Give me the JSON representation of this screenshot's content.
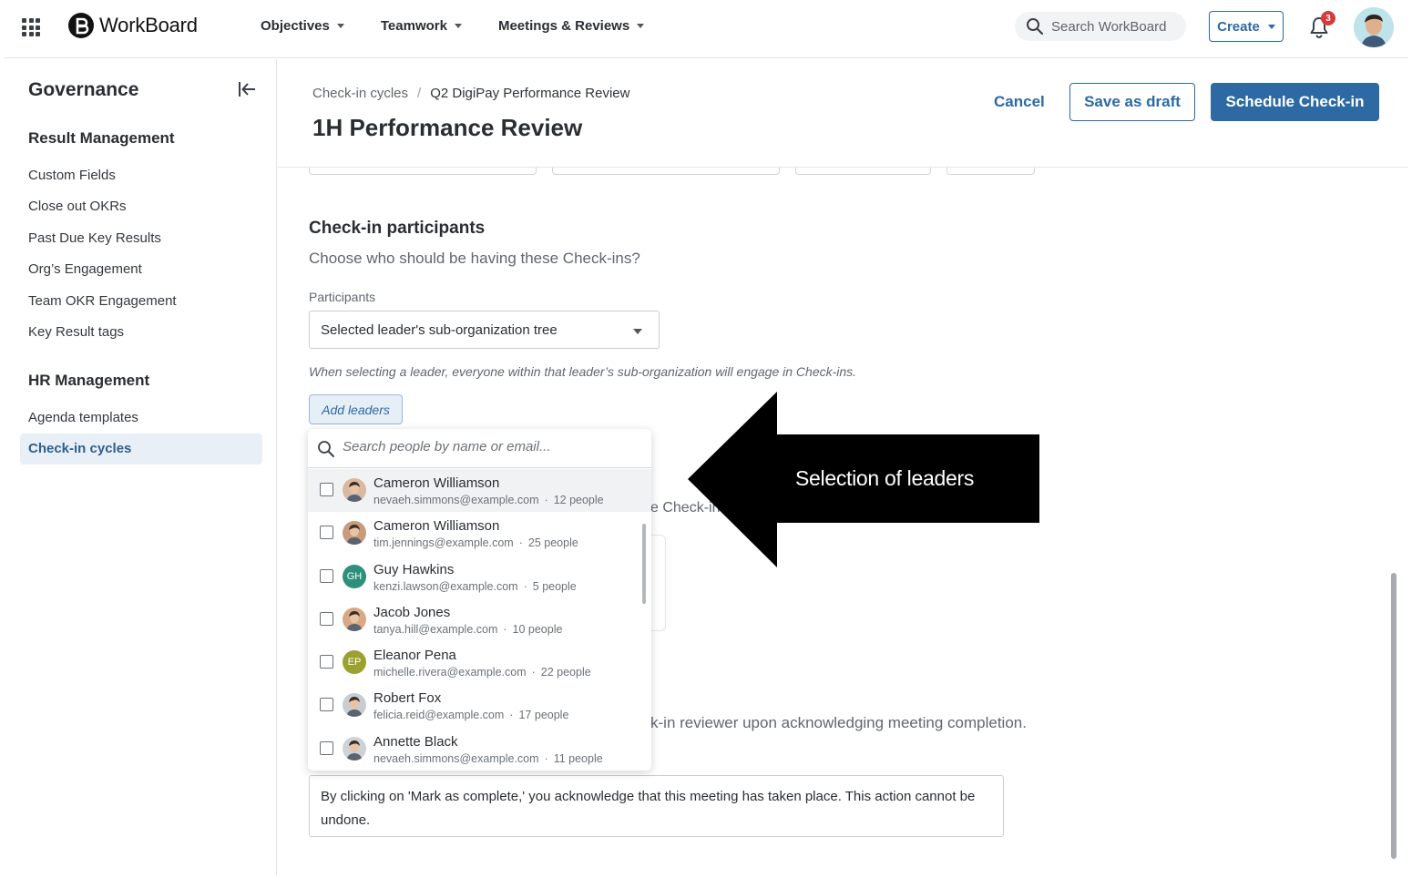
{
  "app": {
    "name": "WorkBoard"
  },
  "topnav": {
    "menus": [
      {
        "label": "Objectives"
      },
      {
        "label": "Teamwork"
      },
      {
        "label": "Meetings & Reviews"
      }
    ],
    "search_placeholder": "Search WorkBoard",
    "create_label": "Create",
    "notifications_count": "3"
  },
  "sidebar": {
    "title": "Governance",
    "sections": [
      {
        "title": "Result Management",
        "items": [
          "Custom Fields",
          "Close out OKRs",
          "Past Due Key Results",
          "Org’s Engagement",
          "Team OKR Engagement",
          "Key Result tags"
        ]
      },
      {
        "title": "HR Management",
        "items": [
          "Agenda templates",
          "Check-in cycles"
        ]
      }
    ],
    "active_item": "Check-in cycles"
  },
  "header": {
    "breadcrumb": [
      "Check-in cycles",
      "/",
      "Q2 DigiPay Performance Review"
    ],
    "title": "1H Performance Review",
    "cancel_label": "Cancel",
    "draft_label": "Save as draft",
    "schedule_label": "Schedule Check-in"
  },
  "participants": {
    "title": "Check-in participants",
    "subtitle": "Choose who should be having these Check-ins?",
    "field_label": "Participants",
    "selected": "Selected leader's sub-organization tree",
    "hint": "When selecting a leader, everyone within that leader’s sub-organization will engage in Check-ins.",
    "add_leaders_label": "Add leaders"
  },
  "leader_picker": {
    "search_placeholder": "Search people by name or email...",
    "people": [
      {
        "name": "Cameron Williamson",
        "email": "nevaeh.simmons@example.com",
        "count": "12 people",
        "initials": "",
        "avatar_color": "#d9b9a1"
      },
      {
        "name": "Cameron Williamson",
        "email": "tim.jennings@example.com",
        "count": "25 people",
        "initials": "",
        "avatar_color": "#c79b7b"
      },
      {
        "name": "Guy Hawkins",
        "email": "kenzi.lawson@example.com",
        "count": "5 people",
        "initials": "GH",
        "avatar_color": "#2e8f7a"
      },
      {
        "name": "Jacob Jones",
        "email": "tanya.hill@example.com",
        "count": "10 people",
        "initials": "",
        "avatar_color": "#d8a984"
      },
      {
        "name": "Eleanor Pena",
        "email": "michelle.rivera@example.com",
        "count": "22 people",
        "initials": "EP",
        "avatar_color": "#9aa12f"
      },
      {
        "name": "Robert Fox",
        "email": "felicia.reid@example.com",
        "count": "17 people",
        "initials": "",
        "avatar_color": "#c8cdd2"
      },
      {
        "name": "Annette Black",
        "email": "nevaeh.simmons@example.com",
        "count": "11 people",
        "initials": "",
        "avatar_color": "#cfd3d6"
      }
    ],
    "separator": "·"
  },
  "background_text": {
    "partial_1": "e Check-in",
    "partial_2": "k-in reviewer upon acknowledging meeting completion.",
    "completion_message": "By clicking on 'Mark as complete,' you acknowledge that this meeting has taken place. This action cannot be undone."
  },
  "annotation": {
    "label": "Selection of leaders"
  },
  "colors": {
    "primary": "#2d6aa3",
    "badge": "#d8393b",
    "active_bg": "#e8eff7"
  }
}
